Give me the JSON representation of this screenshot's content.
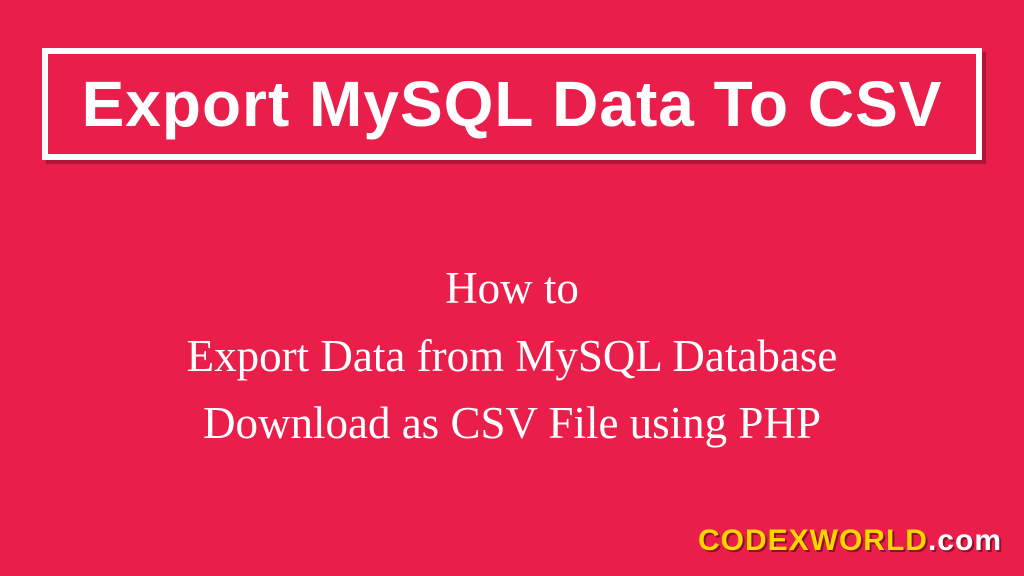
{
  "title": "Export MySQL Data To CSV",
  "subtitle": {
    "line1": "How to",
    "line2": "Export Data from MySQL Database",
    "line3": "Download as CSV File using PHP"
  },
  "watermark": {
    "main": "CODEXWORLD",
    "suffix": ".com"
  },
  "colors": {
    "background": "#e91e4a",
    "text": "#ffffff",
    "accent": "#ffd500"
  }
}
